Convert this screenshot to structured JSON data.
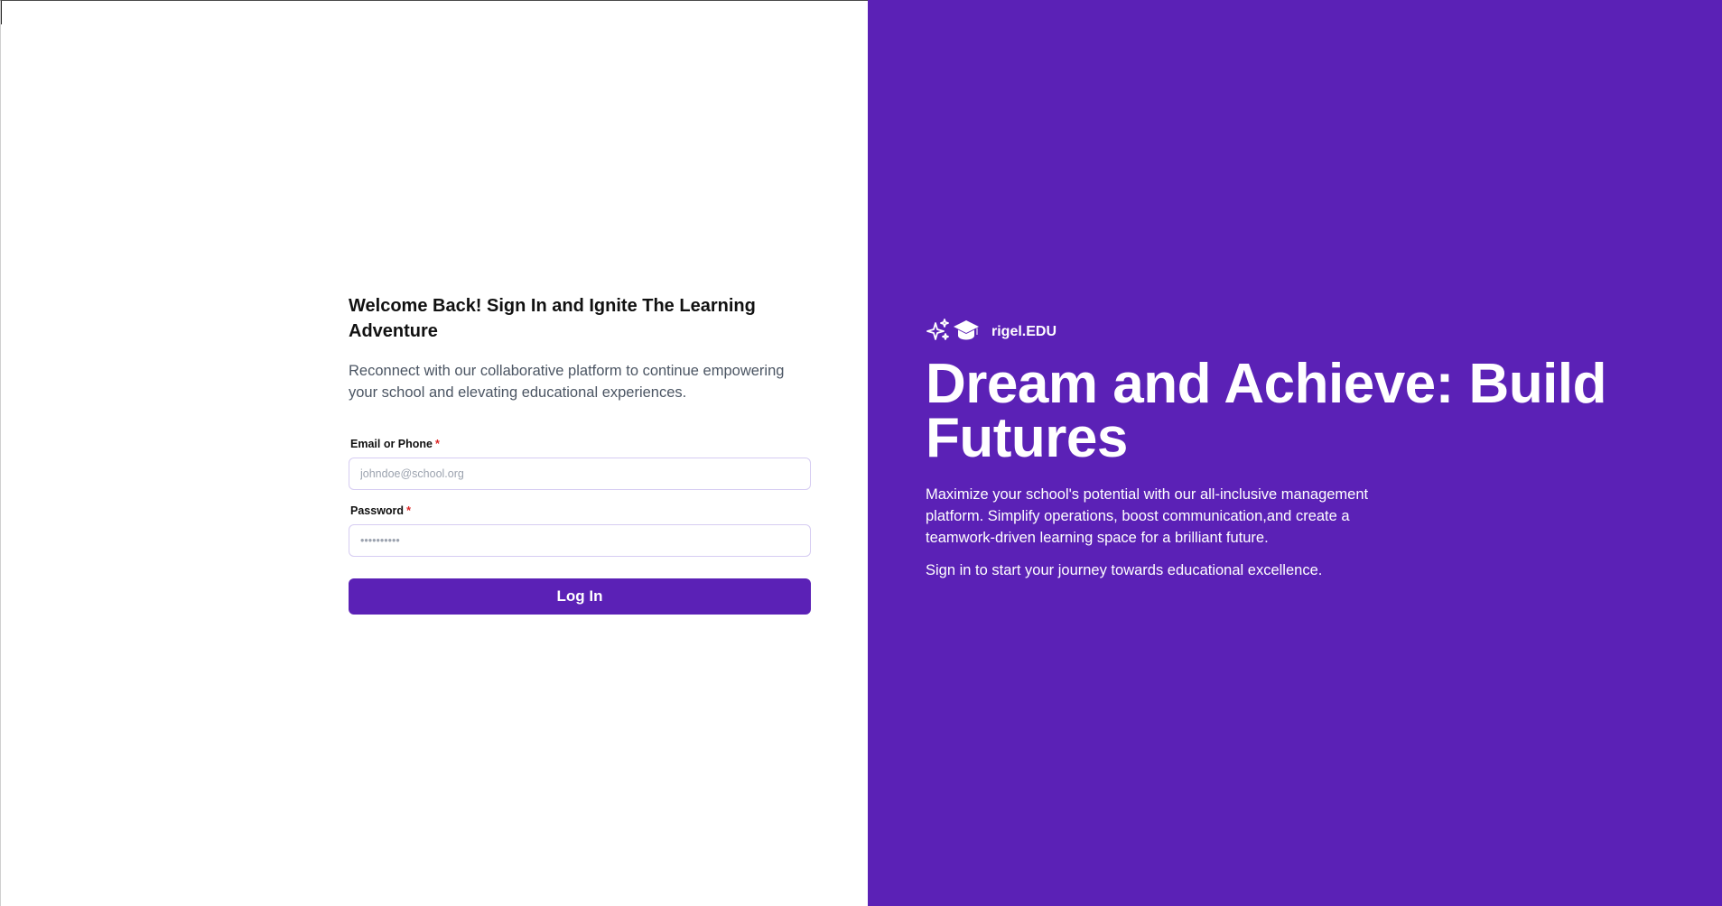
{
  "login": {
    "title": "Welcome Back! Sign In and Ignite The Learning Adventure",
    "subtitle": "Reconnect with our collaborative platform to continue empowering your school and elevating educational experiences.",
    "email": {
      "label": "Email or Phone",
      "required_mark": "*",
      "placeholder": "johndoe@school.org",
      "value": ""
    },
    "password": {
      "label": "Password",
      "required_mark": "*",
      "placeholder": "••••••••••",
      "value": ""
    },
    "submit_label": "Log In"
  },
  "promo": {
    "brand_name": "rigel.EDU",
    "brand_icons": [
      "sparkles-icon",
      "graduation-cap-icon"
    ],
    "headline": "Dream and Achieve: Build Futures",
    "description": "Maximize your school's potential with our all-inclusive management platform. Simplify operations, boost communication,and create a teamwork-driven learning space for a brilliant future.",
    "cta": "Sign in to start your journey towards educational excellence."
  },
  "colors": {
    "accent": "#5b21b6",
    "required": "#dc2626",
    "text_primary": "#111111",
    "text_secondary": "#4b5563",
    "input_border": "#d6ccf2"
  }
}
